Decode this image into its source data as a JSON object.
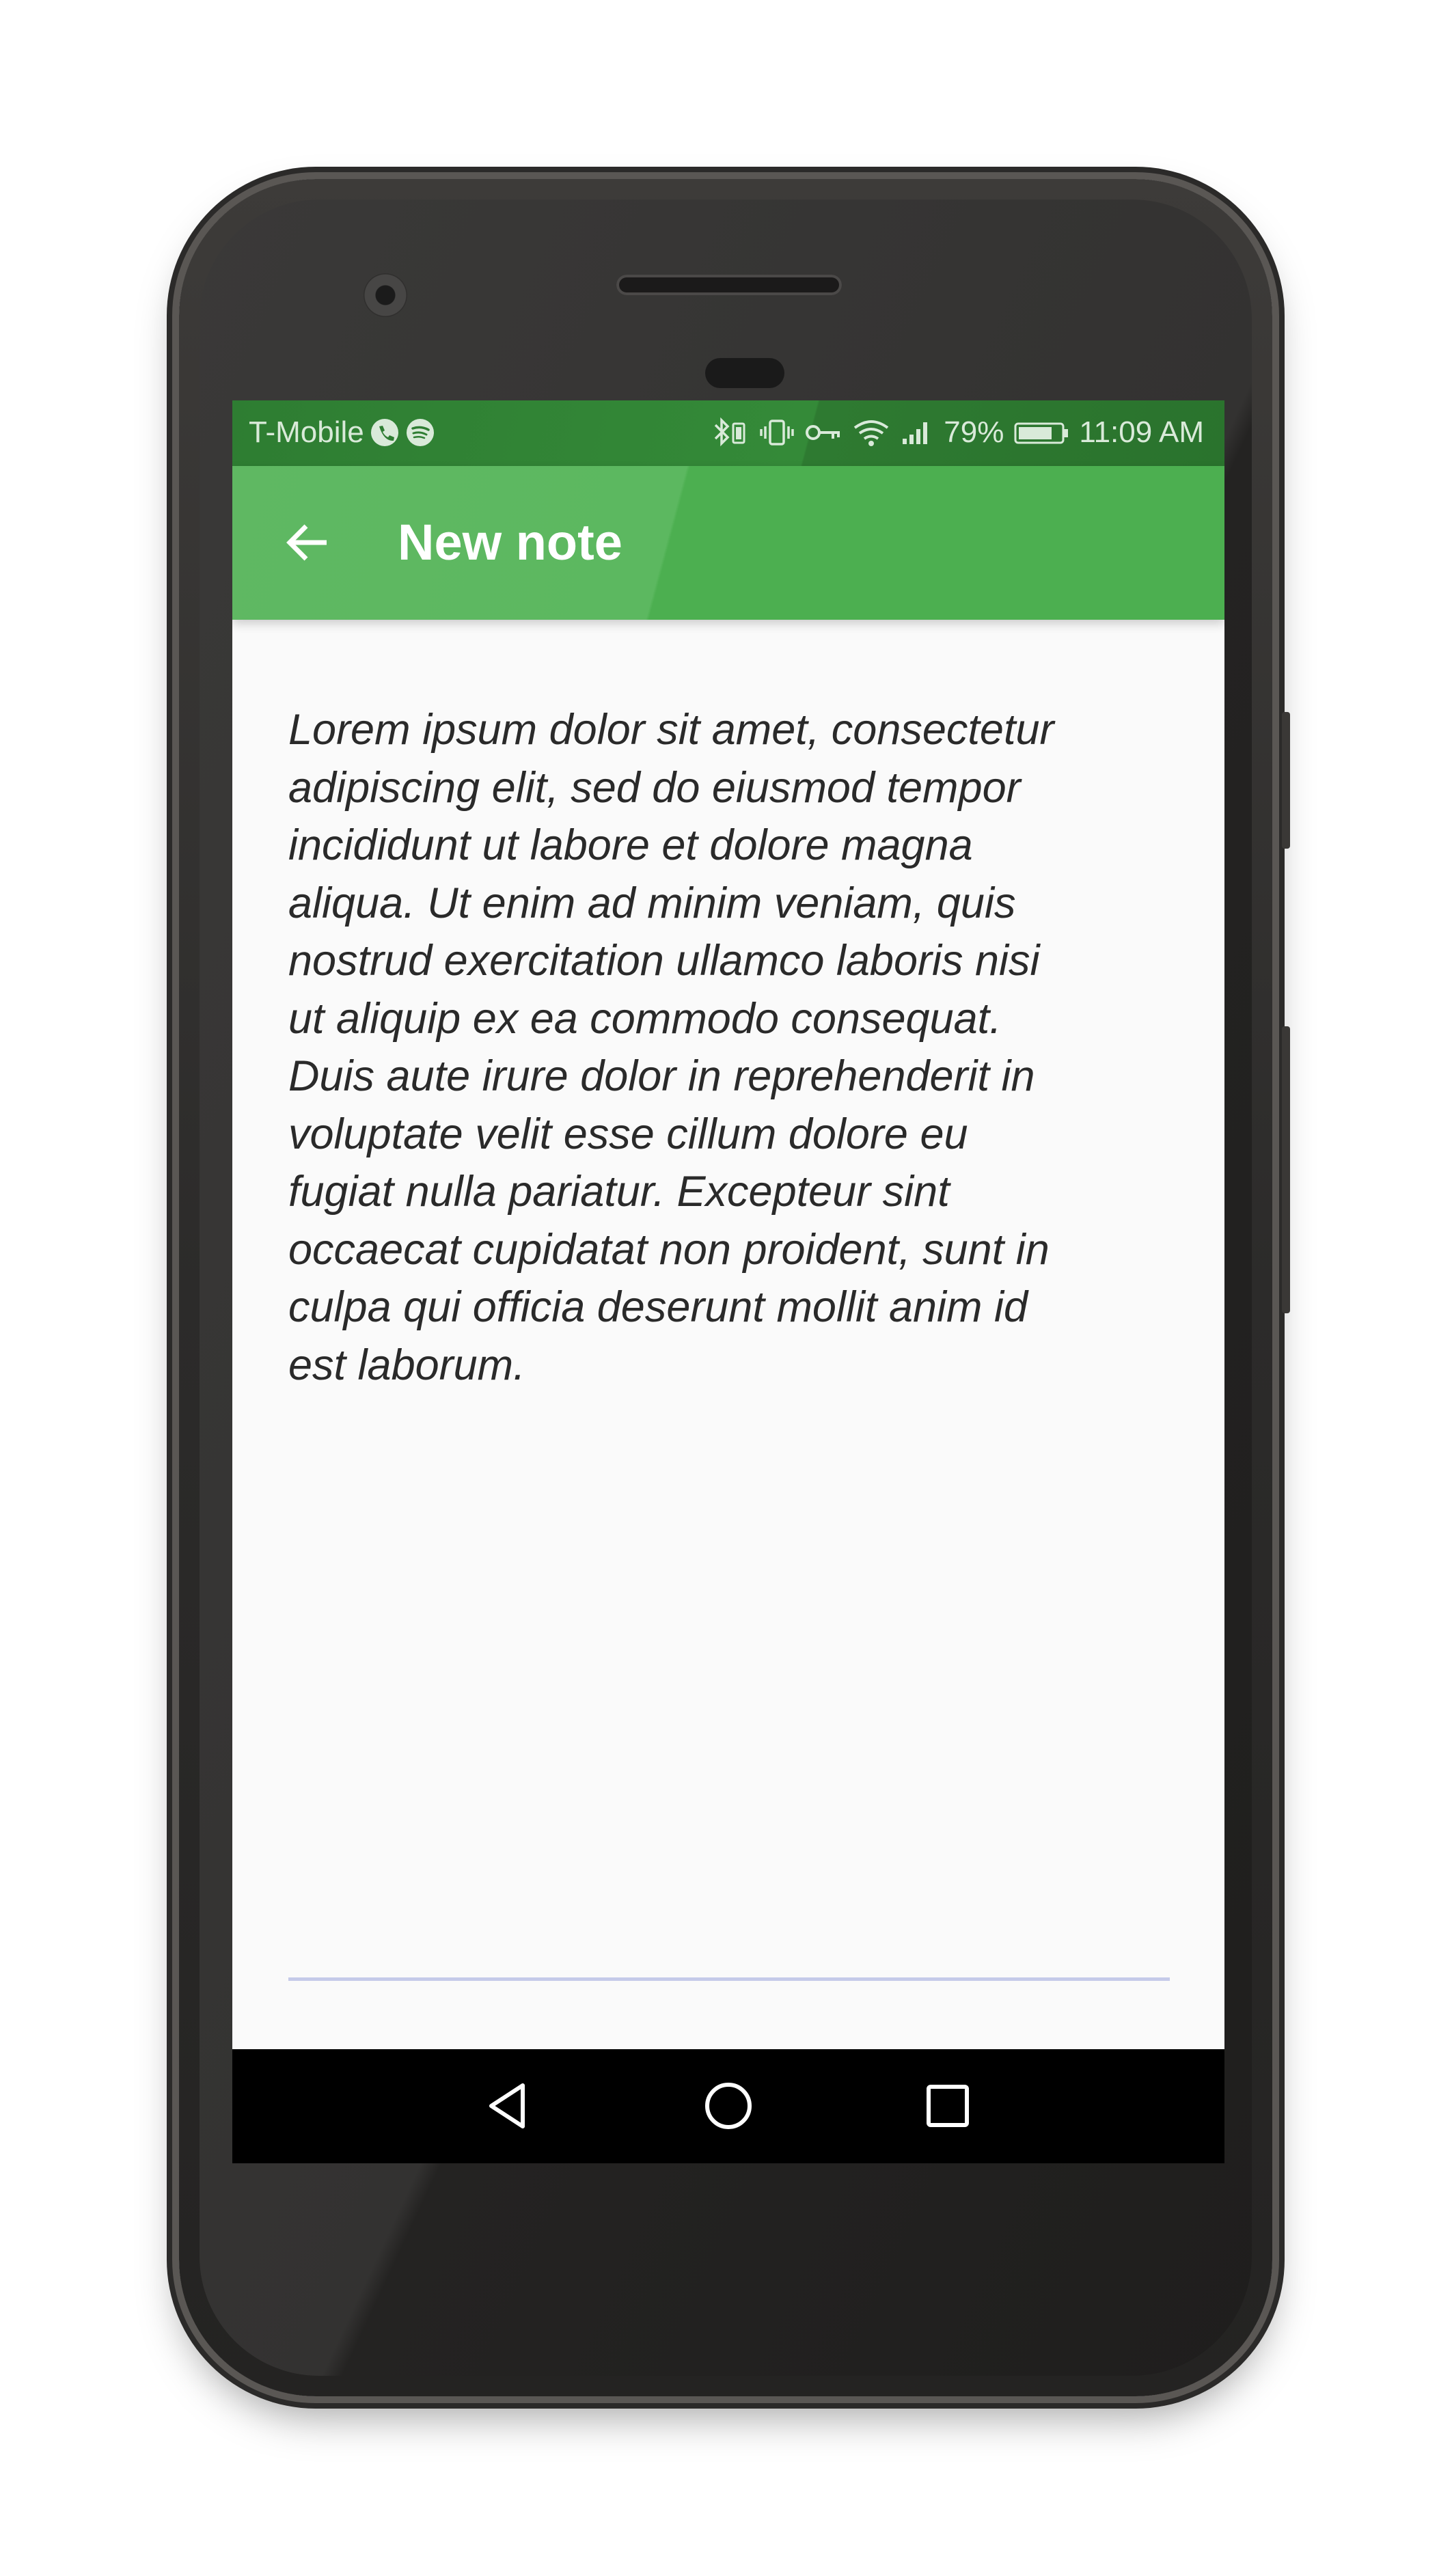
{
  "status_bar": {
    "carrier": "T-Mobile",
    "battery": "79%",
    "time": "11:09 AM",
    "icons": [
      "phone-call-icon",
      "spotify-icon",
      "bluetooth-icon",
      "vibrate-icon",
      "vpn-key-icon",
      "wifi-icon",
      "cell-signal-icon",
      "battery-icon"
    ]
  },
  "app_bar": {
    "back_icon": "arrow-back-icon",
    "title": "New note"
  },
  "note": {
    "body": "Lorem ipsum dolor sit amet, consectetur\nadipiscing elit, sed do eiusmod tempor\nincididunt ut labore et dolore magna\naliqua. Ut enim ad minim veniam, quis\nnostrud exercitation ullamco laboris nisi\nut aliquip ex ea commodo consequat.\nDuis aute irure dolor in reprehenderit in\nvoluptate velit esse cillum dolore eu\nfugiat nulla pariatur. Excepteur sint\noccaecat cupidatat non proident, sunt in\nculpa qui officia deserunt mollit anim id\nest laborum."
  },
  "nav_bar": {
    "buttons": [
      "back-triangle-icon",
      "home-circle-icon",
      "recents-square-icon"
    ]
  },
  "colors": {
    "primary": "#4caf50",
    "primary_dark": "#2e7d32",
    "background": "#fafafa",
    "text": "#2a2a2a",
    "underline": "#c5cae9"
  }
}
